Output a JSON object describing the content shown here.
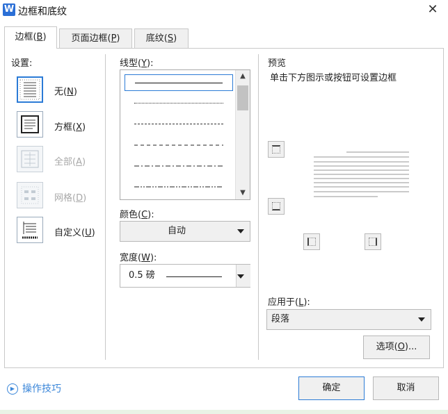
{
  "window": {
    "app_icon": "W",
    "title": "边框和底纹",
    "close_glyph": "✕"
  },
  "tabs": [
    {
      "label": "边框(",
      "key": "B",
      "suffix": ")",
      "active": true
    },
    {
      "label": "页面边框(",
      "key": "P",
      "suffix": ")",
      "active": false
    },
    {
      "label": "底纹(",
      "key": "S",
      "suffix": ")",
      "active": false
    }
  ],
  "settings": {
    "heading": "设置:",
    "items": [
      {
        "label": "无(",
        "key": "N",
        "suffix": ")",
        "state": "selected"
      },
      {
        "label": "方框(",
        "key": "X",
        "suffix": ")",
        "state": "normal"
      },
      {
        "label": "全部(",
        "key": "A",
        "suffix": ")",
        "state": "disabled"
      },
      {
        "label": "网格(",
        "key": "D",
        "suffix": ")",
        "state": "disabled"
      },
      {
        "label": "自定义(",
        "key": "U",
        "suffix": ")",
        "state": "normal"
      }
    ]
  },
  "linestyle": {
    "heading_prefix": "线型(",
    "heading_key": "Y",
    "heading_suffix": "):",
    "styles": [
      "solid",
      "dotted",
      "dashed-fine",
      "dashed",
      "dash-dot",
      "dash-dot-dot"
    ],
    "selected_index": 0
  },
  "color": {
    "heading_prefix": "颜色(",
    "heading_key": "C",
    "heading_suffix": "):",
    "value": "自动"
  },
  "width": {
    "heading_prefix": "宽度(",
    "heading_key": "W",
    "heading_suffix": "):",
    "value": "0.5  磅"
  },
  "preview": {
    "heading": "预览",
    "hint": "单击下方图示或按钮可设置边框"
  },
  "apply": {
    "heading_prefix": "应用于(",
    "heading_key": "L",
    "heading_suffix": "):",
    "value": "段落"
  },
  "options_button": {
    "label": "选项(",
    "key": "O",
    "suffix": ")..."
  },
  "footer": {
    "tips": "操作技巧",
    "ok": "确定",
    "cancel": "取消"
  },
  "colors": {
    "accent": "#2b7bd6",
    "link": "#3a86d9",
    "disabled": "#a8a8a8"
  }
}
